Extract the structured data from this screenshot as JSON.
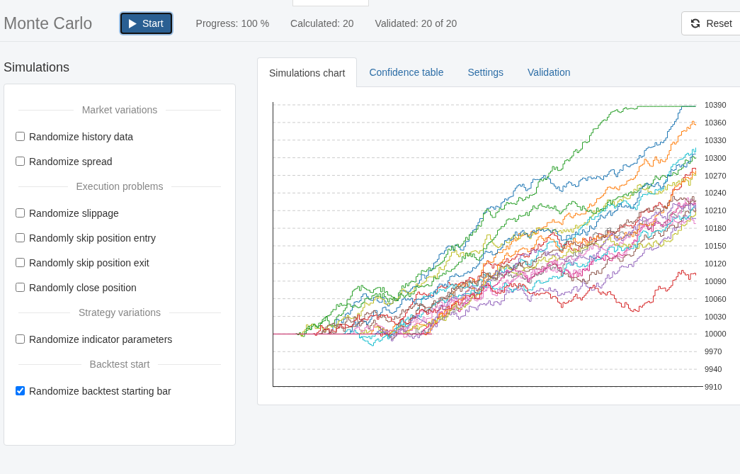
{
  "header": {
    "title": "Monte Carlo",
    "start_label": "Start",
    "stats": [
      "Progress: 100 %",
      "Calculated: 20",
      "Validated: 20 of 20"
    ],
    "reset_label": "Reset"
  },
  "simulations": {
    "heading": "Simulations",
    "sections": [
      {
        "title": "Market variations",
        "options": [
          {
            "label": "Randomize history data",
            "checked": false
          },
          {
            "label": "Randomize spread",
            "checked": false
          }
        ]
      },
      {
        "title": "Execution problems",
        "options": [
          {
            "label": "Randomize slippage",
            "checked": false
          },
          {
            "label": "Randomly skip position entry",
            "checked": false
          },
          {
            "label": "Randomly skip position exit",
            "checked": false
          },
          {
            "label": "Randomly close position",
            "checked": false
          }
        ]
      },
      {
        "title": "Strategy variations",
        "options": [
          {
            "label": "Randomize indicator parameters",
            "checked": false
          }
        ]
      },
      {
        "title": "Backtest start",
        "options": [
          {
            "label": "Randomize backtest starting bar",
            "checked": true
          }
        ]
      }
    ]
  },
  "tabs": [
    {
      "label": "Simulations chart",
      "selected": true
    },
    {
      "label": "Confidence table",
      "selected": false
    },
    {
      "label": "Settings",
      "selected": false
    },
    {
      "label": "Validation",
      "selected": false
    }
  ],
  "chart": {
    "y_axis_labels": [
      "10390",
      "10360",
      "10330",
      "10300",
      "10270",
      "10240",
      "10210",
      "10180",
      "10150",
      "10120",
      "10090",
      "10060",
      "10030",
      "10000",
      "9970",
      "9940",
      "9910"
    ]
  }
}
